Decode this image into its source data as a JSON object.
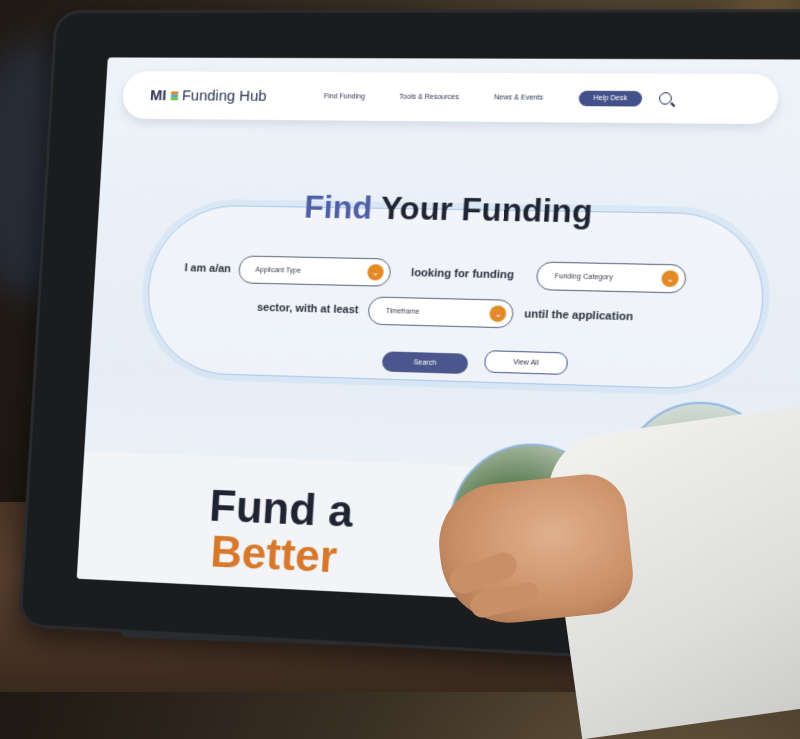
{
  "logo": {
    "prefix": "MI",
    "name": "Funding Hub"
  },
  "nav": {
    "links": [
      "Find Funding",
      "Tools & Resources",
      "News & Events"
    ],
    "help_label": "Help Desk"
  },
  "hero": {
    "title_accent": "Find",
    "title_rest": "Your Funding",
    "text_i_am": "I am a/an",
    "applicant_type": "Applicant Type",
    "text_looking": "looking for funding",
    "funding_category": "Funding Category",
    "text_sector": "sector, with at least",
    "timeframe": "Timeframe",
    "text_until": "until the application",
    "search_label": "Search",
    "view_all_label": "View All"
  },
  "lower": {
    "line1": "Fund a",
    "line2": "Better"
  },
  "colors": {
    "accent_blue": "#4f5fa6",
    "orange": "#e38a26",
    "navy_button": "#43518a"
  }
}
